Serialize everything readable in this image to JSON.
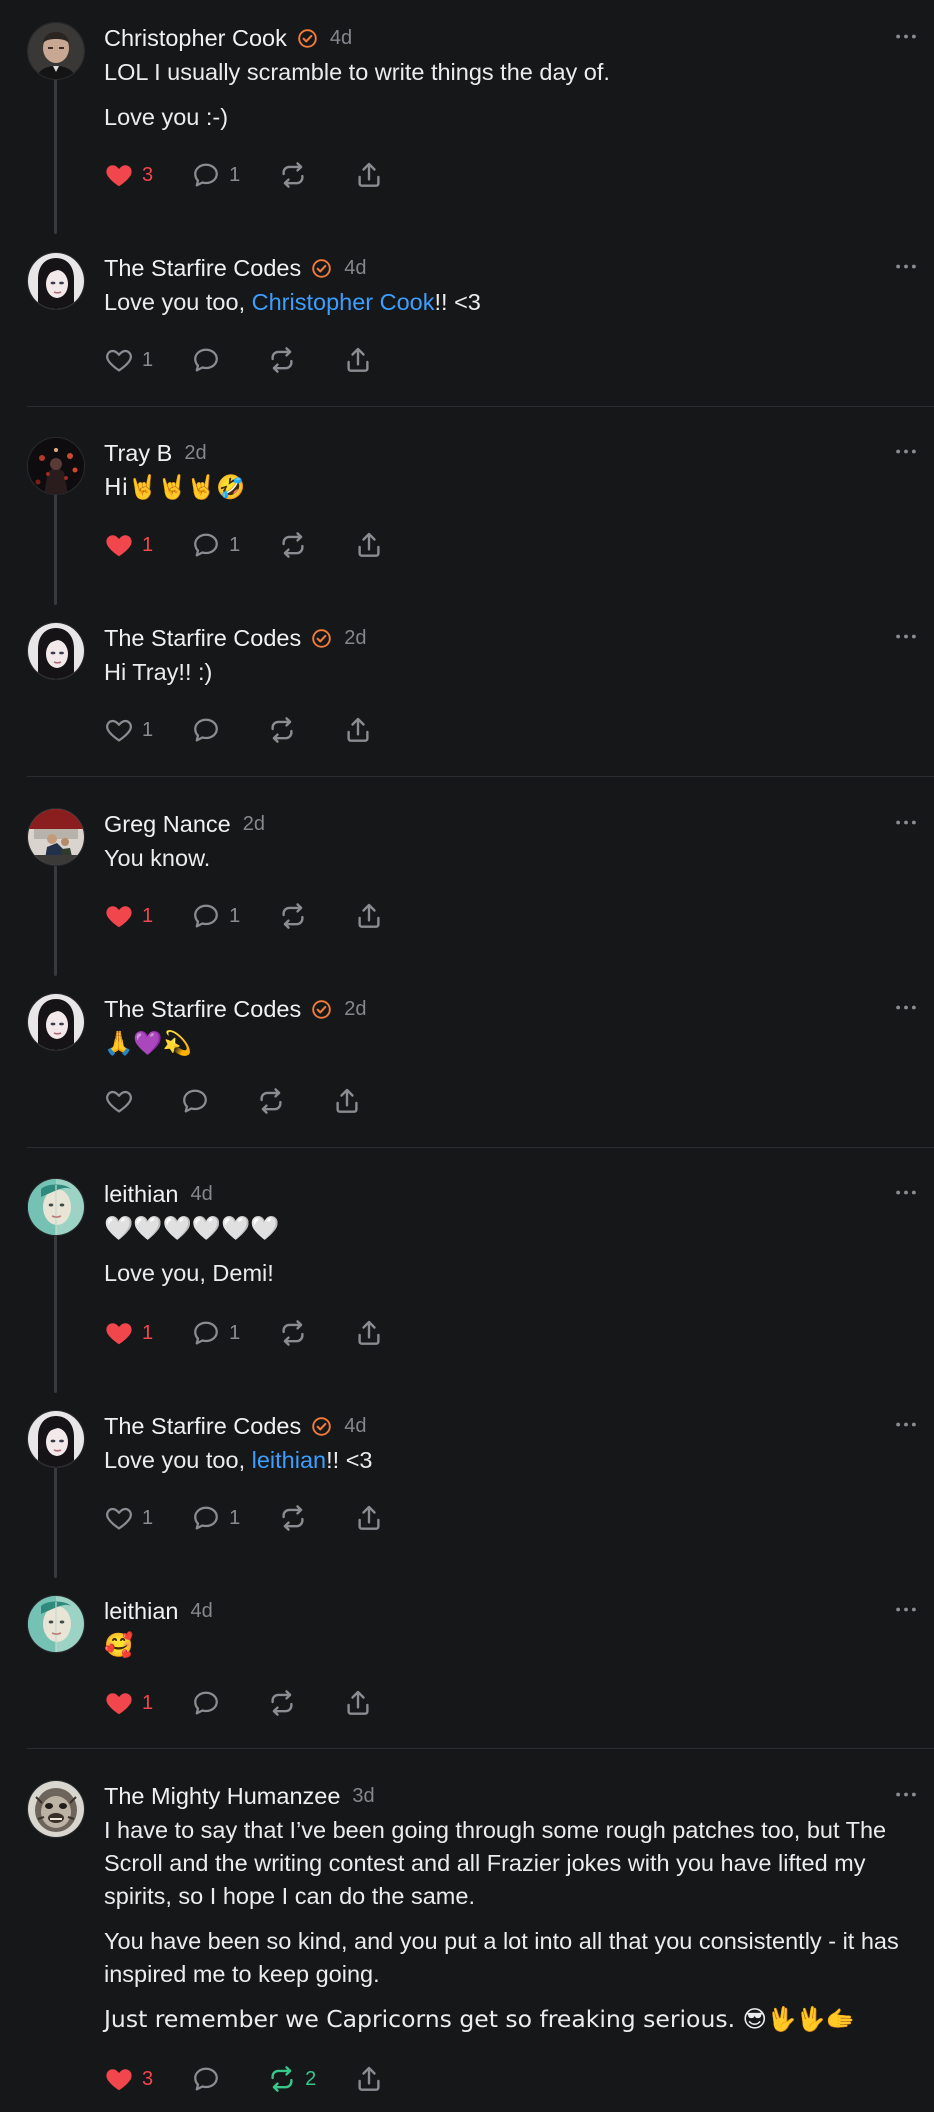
{
  "posts": [
    {
      "name": "Christopher Cook",
      "verified": true,
      "time": "4d",
      "paragraphs": [
        [
          {
            "text": "LOL I usually scramble to write things the day of."
          }
        ],
        [
          {
            "text": "Love you :-)"
          }
        ]
      ],
      "likes": "3",
      "liked": true,
      "comments": "1",
      "reposts": "",
      "reposted": false
    },
    {
      "name": "The Starfire Codes",
      "verified": true,
      "time": "4d",
      "paragraphs": [
        [
          {
            "text": "Love you too, "
          },
          {
            "text": "Christopher Cook",
            "mention": true
          },
          {
            "text": "!! <3"
          }
        ]
      ],
      "likes": "1",
      "liked": false,
      "comments": "",
      "reposts": "",
      "reposted": false
    },
    {
      "name": "Tray B",
      "verified": false,
      "time": "2d",
      "paragraphs": [
        [
          {
            "text": "Hi🤘🤘🤘🤣"
          }
        ]
      ],
      "likes": "1",
      "liked": true,
      "comments": "1",
      "reposts": "",
      "reposted": false
    },
    {
      "name": "The Starfire Codes",
      "verified": true,
      "time": "2d",
      "paragraphs": [
        [
          {
            "text": "Hi Tray!! :)"
          }
        ]
      ],
      "likes": "1",
      "liked": false,
      "comments": "",
      "reposts": "",
      "reposted": false
    },
    {
      "name": "Greg Nance",
      "verified": false,
      "time": "2d",
      "paragraphs": [
        [
          {
            "text": "You know."
          }
        ]
      ],
      "likes": "1",
      "liked": true,
      "comments": "1",
      "reposts": "",
      "reposted": false
    },
    {
      "name": "The Starfire Codes",
      "verified": true,
      "time": "2d",
      "paragraphs": [
        [
          {
            "text": "🙏💜💫"
          }
        ]
      ],
      "likes": "",
      "liked": false,
      "comments": "",
      "reposts": "",
      "reposted": false
    },
    {
      "name": "leithian",
      "verified": false,
      "time": "4d",
      "paragraphs": [
        [
          {
            "text": "🤍🤍🤍🤍🤍🤍"
          }
        ],
        [
          {
            "text": "Love you, Demi!"
          }
        ]
      ],
      "likes": "1",
      "liked": true,
      "comments": "1",
      "reposts": "",
      "reposted": false
    },
    {
      "name": "The Starfire Codes",
      "verified": true,
      "time": "4d",
      "paragraphs": [
        [
          {
            "text": "Love you too, "
          },
          {
            "text": "leithian",
            "mention": true
          },
          {
            "text": "!! <3"
          }
        ]
      ],
      "likes": "1",
      "liked": false,
      "comments": "1",
      "reposts": "",
      "reposted": false
    },
    {
      "name": "leithian",
      "verified": false,
      "time": "4d",
      "paragraphs": [
        [
          {
            "text": "🥰"
          }
        ]
      ],
      "likes": "1",
      "liked": true,
      "comments": "",
      "reposts": "",
      "reposted": false
    },
    {
      "name": "The Mighty Humanzee",
      "verified": false,
      "time": "3d",
      "paragraphs": [
        [
          {
            "text": "I have to say that I’ve been going through some rough patches too, but The Scroll and the writing contest and all Frazier jokes with you have lifted my spirits, so I hope I can do the same."
          }
        ],
        [
          {
            "text": "You have been so kind, and you put a lot into all that you consistently - it has inspired me to keep going."
          }
        ],
        [
          {
            "text": "Just remember we Capricorns get so freaking serious. 😎🖖🖖🫱"
          }
        ]
      ],
      "likes": "3",
      "liked": true,
      "comments": "",
      "reposts": "2",
      "reposted": true
    }
  ],
  "colors": {
    "background": "#161719",
    "accent_orange": "#f07b3a",
    "like_red": "#f0464c",
    "mention_blue": "#3c9eff",
    "repost_green": "#37c78a"
  },
  "icons": [
    "verified-badge-icon",
    "more-icon",
    "heart-icon",
    "comment-icon",
    "repost-icon",
    "share-icon"
  ]
}
